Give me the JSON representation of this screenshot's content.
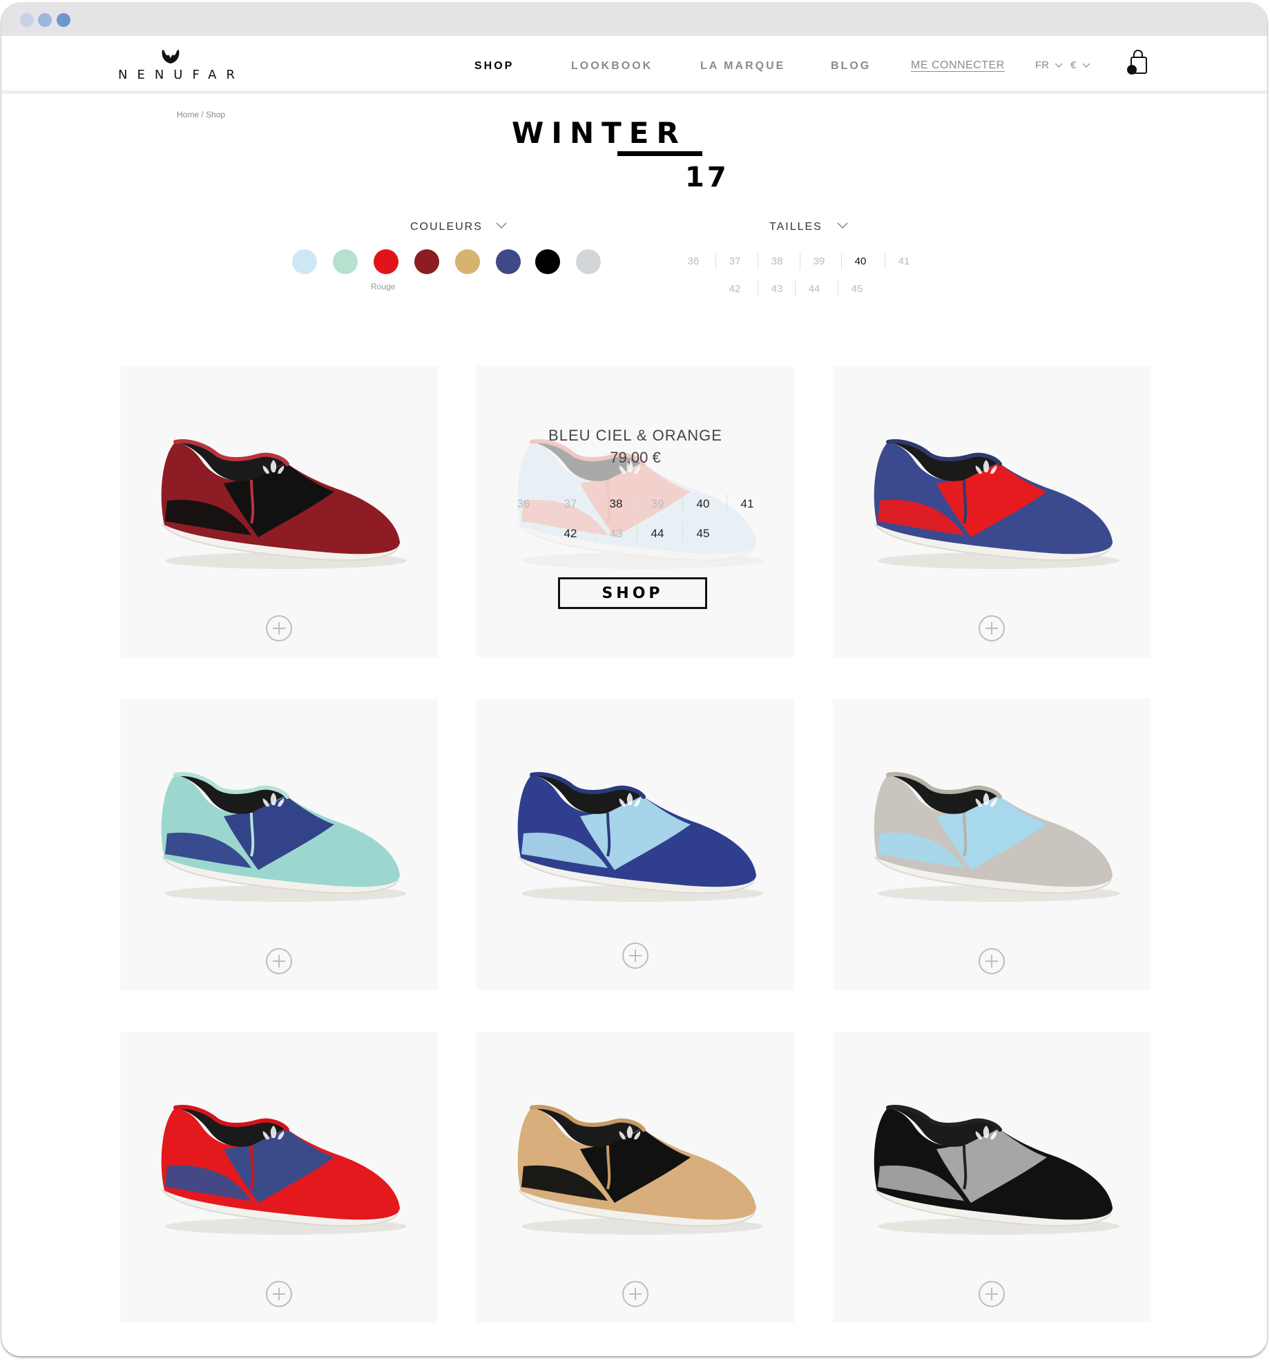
{
  "logo": {
    "text": "NENUFAR"
  },
  "nav": {
    "shop": "SHOP",
    "lookbook": "LOOKBOOK",
    "la_marque": "LA MARQUE",
    "blog": "BLOG",
    "login": "ME CONNECTER",
    "language": "FR",
    "currency": "€"
  },
  "breadcrumb": "Home / Shop",
  "title": {
    "line1": "WINTER",
    "line2": "17"
  },
  "filters": {
    "colors_label": "COULEURS",
    "sizes_label": "TAILLES",
    "selected_color_caption": "Rouge",
    "colors": [
      "#cfe6f6",
      "#b6e1cd",
      "#e1141c",
      "#8d1c24",
      "#d6b36e",
      "#3e4a86",
      "#000000",
      "#d3d6d8"
    ],
    "sizes_row1": [
      "36",
      "37",
      "38",
      "39",
      "40",
      "41"
    ],
    "sizes_row2": [
      "42",
      "43",
      "44",
      "45"
    ],
    "selected_size": "40"
  },
  "products": [
    {
      "upper": "#8e1c25",
      "vamp": "#111111",
      "trim": "#b8333d"
    },
    {
      "upper": "#cfe4f1",
      "vamp": "#e98a7e",
      "trim": "#e27063"
    },
    {
      "upper": "#3b4a8f",
      "vamp": "#e51b1f",
      "trim": "#2e3a6e"
    },
    {
      "upper": "#9bd7cf",
      "vamp": "#33438a",
      "trim": "#b4e1da"
    },
    {
      "upper": "#2f3f8e",
      "vamp": "#a7d4ea",
      "trim": "#2b3a7e"
    },
    {
      "upper": "#c9c4bd",
      "vamp": "#a8d8ec",
      "trim": "#b7b1a8"
    },
    {
      "upper": "#e3191d",
      "vamp": "#3b4b8a",
      "trim": "#d2141a"
    },
    {
      "upper": "#d7ae7c",
      "vamp": "#111111",
      "trim": "#c89a66"
    },
    {
      "upper": "#111111",
      "vamp": "#a6a6a6",
      "trim": "#222222"
    }
  ],
  "quick_view": {
    "name": "BLEU CIEL & ORANGE",
    "price": "79,00 €",
    "sizes_row1": [
      "36",
      "37",
      "38",
      "39",
      "40",
      "41"
    ],
    "sizes_row2": [
      "42",
      "43",
      "44",
      "45"
    ],
    "available_row1": [
      "38",
      "40",
      "41"
    ],
    "available_row2": [
      "42",
      "44",
      "45"
    ],
    "shop_button": "SHOP"
  }
}
